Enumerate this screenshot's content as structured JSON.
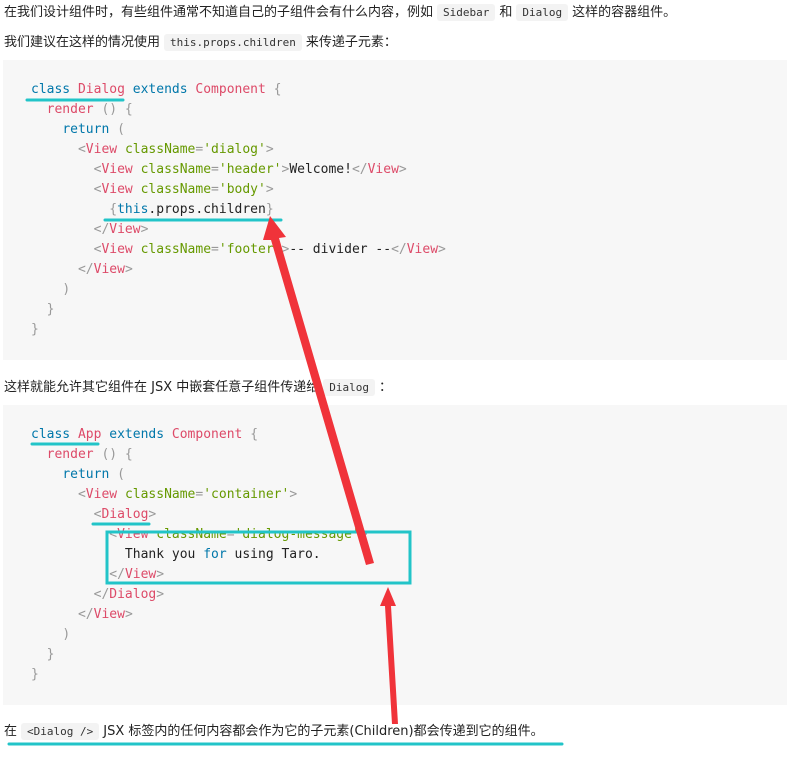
{
  "intro": {
    "line1_a": "在我们设计组件时，有些组件通常不知道自己的子组件会有什么内容，例如",
    "line1_code1": "Sidebar",
    "line1_b": "和",
    "line1_code2": "Dialog",
    "line1_c": "这样的容器组件。",
    "line2_a": "我们建议在这样的情况使用",
    "line2_code": "this.props.children",
    "line2_b": "来传递子元素："
  },
  "code1": {
    "kw_class": "class",
    "name": "Dialog",
    "kw_extends": "extends",
    "base": "Component",
    "brace_open": "{",
    "render": "render",
    "render_paren": "() {",
    "return": "return",
    "return_paren": "(",
    "view_tag": "View",
    "class_attr": "className",
    "val_dialog": "'dialog'",
    "val_header": "'header'",
    "welcome": "Welcome!",
    "val_body": "'body'",
    "children_this": "this",
    "children_rest": ".props.children",
    "val_footer": "'footer'",
    "divider": "-- divider --",
    "close_paren": ")",
    "close_brace": "}"
  },
  "mid": {
    "text_a": "这样就能允许其它组件在 JSX 中嵌套任意子组件传递给",
    "code": "Dialog",
    "text_b": "："
  },
  "code2": {
    "kw_class": "class",
    "name": "App",
    "kw_extends": "extends",
    "base": "Component",
    "brace_open": "{",
    "render": "render",
    "render_paren": "() {",
    "return": "return",
    "return_paren": "(",
    "view_tag": "View",
    "class_attr": "className",
    "val_container": "'container'",
    "dialog_tag": "Dialog",
    "val_message": "'dialog-message'",
    "thank": "Thank you ",
    "for_kw": "for",
    "using": " using Taro.",
    "close_paren": ")",
    "close_brace": "}"
  },
  "outro": {
    "text_a": "在",
    "code": "<Dialog />",
    "text_b": "JSX 标签内的任何内容都会作为它的子元素(Children)都会传递到它的组件。"
  },
  "colors": {
    "annotation_underline": "#22c4c8",
    "annotation_arrow": "#f0333a",
    "code_background": "#f7f7f7"
  }
}
